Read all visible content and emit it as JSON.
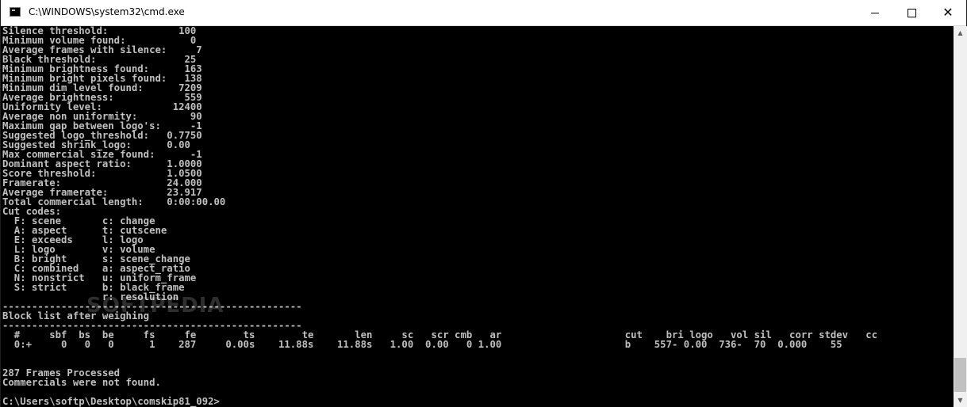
{
  "window": {
    "title": "C:\\WINDOWS\\system32\\cmd.exe",
    "minimize_label": "—",
    "maximize_label": "☐",
    "close_label": "✕"
  },
  "console": {
    "text": "Silence threshold:            100\nMinimum volume found:           0\nAverage frames with silence:     7\nBlack threshold:               25\nMinimum brightness found:      163\nMinimum bright pixels found:   138\nMinimum dim level found:      7209\nAverage brightness:            559\nUniformity level:            12400\nAverage non uniformity:         90\nMaximum gap between logo's:     -1\nSuggested logo_threshold:   0.7750\nSuggested shrink_logo:      0.00\nMax commercial size found:      -1\nDominant aspect ratio:      1.0000\nScore threshold:            1.0500\nFramerate:                  24.000\nAverage framerate:          23.917\nTotal commercial length:    0:00:00.00\nCut codes:\n  F: scene       c: change\n  A: aspect      t: cutscene\n  E: exceeds     l: logo\n  L: logo        v: volume\n  B: bright      s: scene_change\n  C: combined    a: aspect_ratio\n  N: nonstrict   u: uniform_frame\n  S: strict      b: black_frame\n                 r: resolution\n---------------------------------------------------\nBlock list after weighing\n---------------------------------------------------\n  #     sbf  bs  be     fs     fe        ts        te       len     sc   scr cmb   ar                     cut    bri logo   vol sil   corr stdev   cc\n  0:+     0   0   0      1    287     0.00s    11.88s    11.88s   1.00  0.00   0 1.00                     b    557- 0.00  736-  70  0.000    55\n\n\n287 Frames Processed\nCommercials were not found.\n\nC:\\Users\\softp\\Desktop\\comskip81_092>"
  },
  "watermark": {
    "text": "SOFTPEDIA"
  },
  "scrollbar": {
    "up_icon": "▲",
    "down_icon": "▼"
  }
}
